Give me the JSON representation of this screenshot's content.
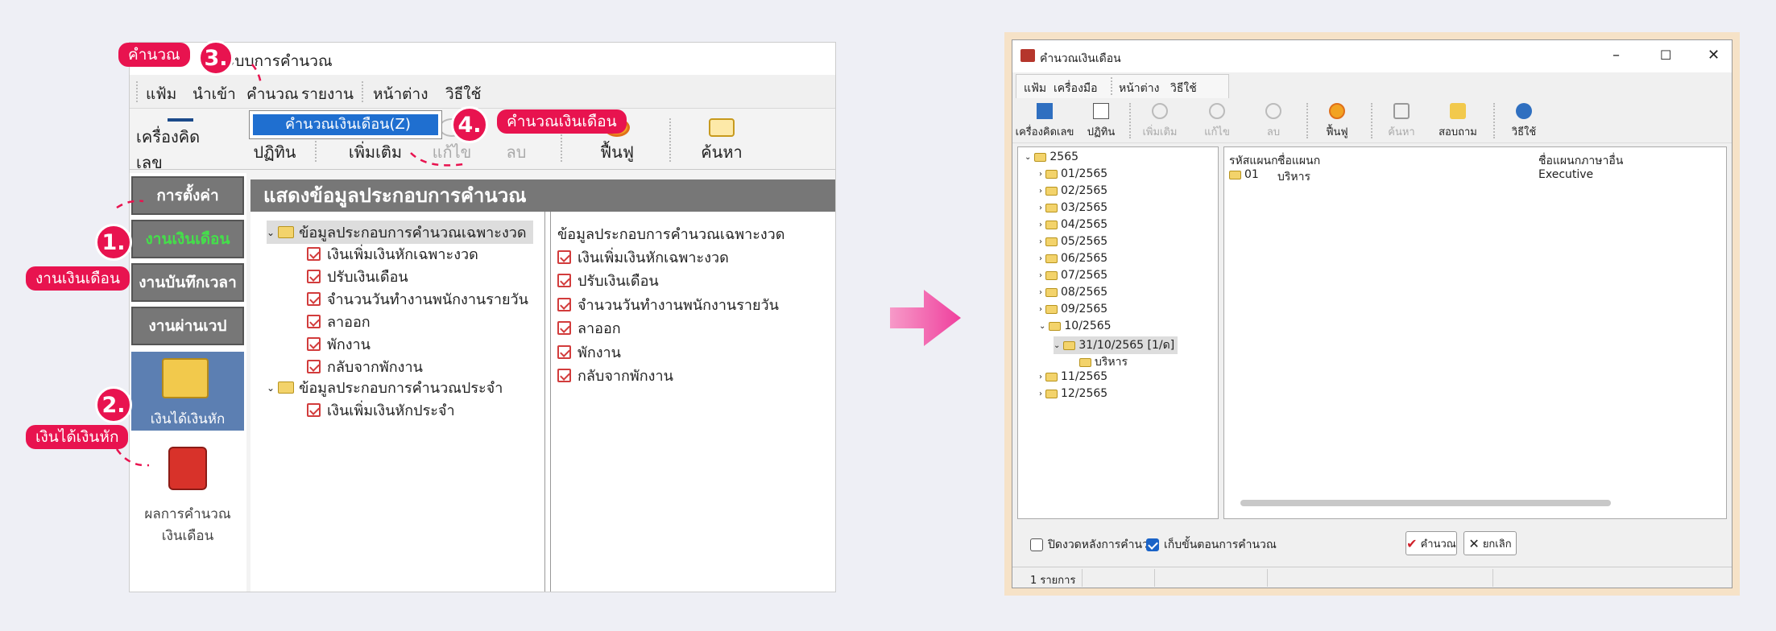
{
  "left_window": {
    "title_suffix": "ระบบการคำนวณ",
    "menu": [
      "แฟ้ม",
      "นำเข้า",
      "คำนวณ",
      "รายงาน",
      "หน้าต่าง",
      "วิธีใช้"
    ],
    "dropdown_item": "คำนวณเงินเดือน(Z)",
    "toolbar": [
      "เครื่องคิดเลข",
      "ปฏิทิน",
      "เพิ่มเติม",
      "แก้ไข",
      "ลบ",
      "ฟื้นฟู",
      "ค้นหา"
    ],
    "sidebar": [
      "การตั้งค่า",
      "งานเงินเดือน",
      "งานบันทึกเวลา",
      "งานผ่านเวป",
      "เงินได้เงินหัก",
      "ผลการคำนวณ\nเงินเดือน"
    ],
    "panel_title": "แสดงข้อมูลประกอบการคำนวณ",
    "tree_group1": "ข้อมูลประกอบการคำนวณเฉพาะงวด",
    "tree_group1_items": [
      "เงินเพิ่มเงินหักเฉพาะงวด",
      "ปรับเงินเดือน",
      "จำนวนวันทำงานพนักงานรายวัน",
      "ลาออก",
      "พักงาน",
      "กลับจากพักงาน"
    ],
    "tree_group2": "ข้อมูลประกอบการคำนวณประจำ",
    "tree_group2_items": [
      "เงินเพิ่มเงินหักประจำ"
    ],
    "right_heading": "ข้อมูลประกอบการคำนวณเฉพาะงวด",
    "right_items": [
      "เงินเพิ่มเงินหักเฉพาะงวด",
      "ปรับเงินเดือน",
      "จำนวนวันทำงานพนักงานรายวัน",
      "ลาออก",
      "พักงาน",
      "กลับจากพักงาน"
    ]
  },
  "annotations": {
    "steps": [
      "1.",
      "2.",
      "3.",
      "4."
    ],
    "labels": [
      "งานเงินเดือน",
      "เงินได้เงินหัก",
      "คำนวณ",
      "คำนวณเงินเดือน"
    ],
    "accent_color": "#e8134f"
  },
  "arrow_color": "#f24fa3",
  "right_window": {
    "title": "คำนวณเงินเดือน",
    "controls": [
      "–",
      "☐",
      "✕"
    ],
    "menu": [
      "แฟ้ม",
      "เครื่องมือ",
      "หน้าต่าง",
      "วิธีใช้"
    ],
    "toolbar": [
      "เครื่องคิดเลข",
      "ปฏิทิน",
      "เพิ่มเติม",
      "แก้ไข",
      "ลบ",
      "ฟื้นฟู",
      "ค้นหา",
      "สอบถาม",
      "วิธีใช้"
    ],
    "tree_root": "2565",
    "tree_months": [
      "01/2565",
      "02/2565",
      "03/2565",
      "04/2565",
      "05/2565",
      "06/2565",
      "07/2565",
      "08/2565",
      "09/2565",
      "10/2565"
    ],
    "tree_period": "31/10/2565 [1/ด]",
    "tree_dept": "บริหาร",
    "tree_months_after": [
      "11/2565",
      "12/2565"
    ],
    "columns": [
      "รหัสแผนก",
      "ชื่อแผนก",
      "ชื่อแผนกภาษาอื่น"
    ],
    "rows": [
      {
        "code": "01",
        "name": "บริหาร",
        "other": "Executive"
      }
    ],
    "check_close": "ปิดงวดหลังการคำนวณ",
    "check_keep": "เก็บขั้นตอนการคำนวณ",
    "ok_button": "คำนวณ",
    "cancel_button": "ยกเลิก",
    "status": "1 รายการ"
  }
}
